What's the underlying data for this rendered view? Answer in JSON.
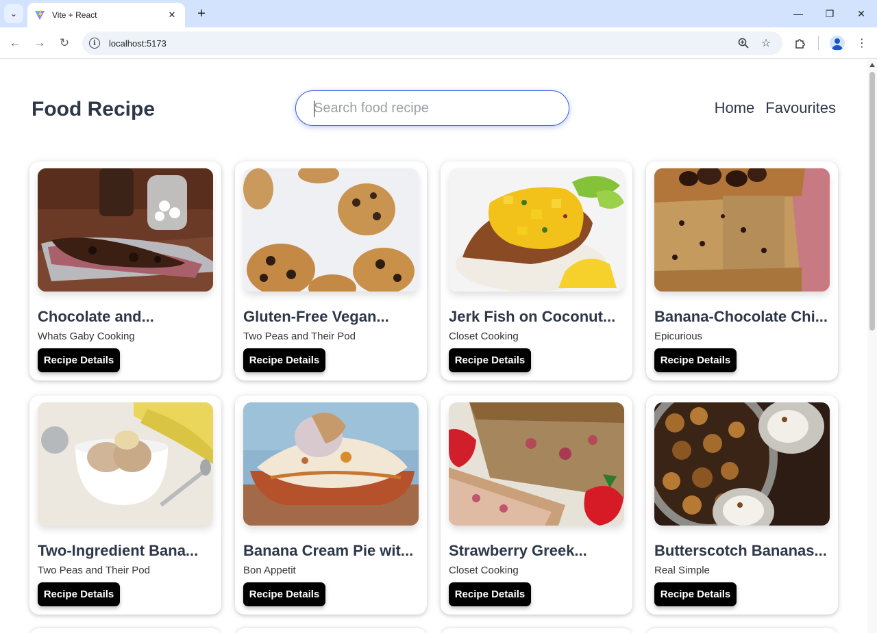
{
  "browser": {
    "tab_title": "Vite + React",
    "url": "localhost:5173",
    "icons": [
      "tab-search-icon",
      "vite-favicon",
      "close-icon",
      "plus-icon",
      "minimize-icon",
      "restore-icon",
      "window-close-icon",
      "back-icon",
      "forward-icon",
      "reload-icon",
      "info-icon",
      "zoom-icon",
      "star-icon",
      "extensions-icon",
      "profile-icon",
      "more-icon"
    ]
  },
  "header": {
    "brand": "Food Recipe",
    "search_placeholder": "Search food recipe",
    "search_value": "",
    "nav": [
      "Home",
      "Favourites"
    ]
  },
  "recipes": [
    {
      "title": "Chocolate and...",
      "publisher": "Whats Gaby Cooking",
      "button": "Recipe Details"
    },
    {
      "title": "Gluten-Free Vegan...",
      "publisher": "Two Peas and Their Pod",
      "button": "Recipe Details"
    },
    {
      "title": "Jerk Fish on Coconut...",
      "publisher": "Closet Cooking",
      "button": "Recipe Details"
    },
    {
      "title": "Banana-Chocolate Chi...",
      "publisher": "Epicurious",
      "button": "Recipe Details"
    },
    {
      "title": "Two-Ingredient Bana...",
      "publisher": "Two Peas and Their Pod",
      "button": "Recipe Details"
    },
    {
      "title": "Banana Cream Pie wit...",
      "publisher": "Bon Appetit",
      "button": "Recipe Details"
    },
    {
      "title": "Strawberry Greek...",
      "publisher": "Closet Cooking",
      "button": "Recipe Details"
    },
    {
      "title": "Butterscotch Bananas...",
      "publisher": "Real Simple",
      "button": "Recipe Details"
    }
  ],
  "colors": {
    "tabbar": "#d3e3fd",
    "search_border": "#3b5bdb",
    "text_dark": "#2d3748",
    "button_bg": "#000000"
  }
}
